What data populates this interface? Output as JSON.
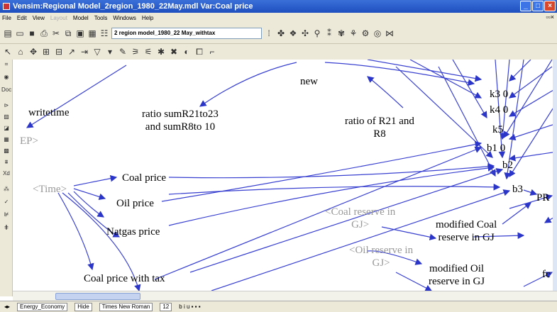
{
  "window": {
    "title": "Vensim:Regional Model_2region_1980_22May.mdl Var:Coal price"
  },
  "menu": {
    "items": [
      "File",
      "Edit",
      "View",
      "Layout",
      "Model",
      "Tools",
      "Windows",
      "Help"
    ]
  },
  "toolbar": {
    "model_name": "2 region model_1980_22 May_withtax"
  },
  "diagram": {
    "writetime": "writetime",
    "ep": "EP>",
    "new": "new",
    "ratio_sum_1": "ratio sumR21to23",
    "ratio_sum_2": "and sumR8to 10",
    "ratio_r21_1": "ratio of R21 and",
    "ratio_r21_2": "R8",
    "k3": "k3 0",
    "k4": "k4 0",
    "k5": "k5",
    "b1": "b1 0",
    "b2": "b2",
    "b3": "b3",
    "pr": "PR",
    "time": "<Time>",
    "coal_price": "Coal price",
    "oil_price": "Oil price",
    "natgas_price": "Natgas price",
    "coal_price_tax": "Coal price with tax",
    "coal_reserve_1": "<Coal reserve in",
    "coal_reserve_2": "GJ>",
    "mod_coal_1": "modified Coal",
    "mod_coal_2": "reserve in GJ",
    "oil_reserve_1": "<Oil reserve in",
    "oil_reserve_2": "GJ>",
    "mod_oil_1": "modified Oil",
    "mod_oil_2": "reserve in GJ",
    "fc": "fc"
  },
  "statusbar": {
    "view": "Energy_Economy",
    "hide": "Hide",
    "font": "Times New Roman",
    "size": "12"
  }
}
